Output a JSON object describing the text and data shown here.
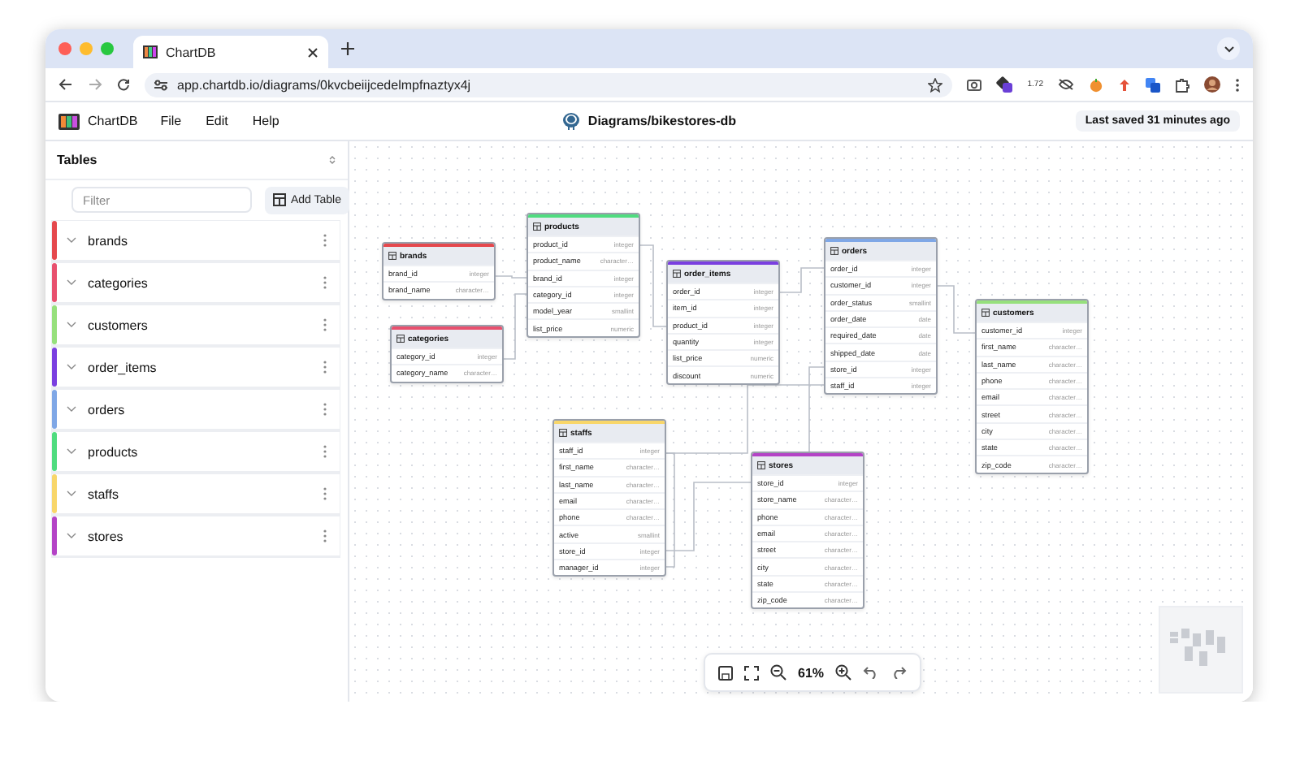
{
  "browser": {
    "tab_title": "ChartDB",
    "url": "app.chartdb.io/diagrams/0kvcbeiijcedelmpfnaztyx4j",
    "extension_badge": "1.72"
  },
  "app": {
    "logo_text": "ChartDB",
    "menu": [
      "File",
      "Edit",
      "Help"
    ],
    "diagram_title": "Diagrams/bikestores-db",
    "save_status": "Last saved 31 minutes ago"
  },
  "sidebar": {
    "title": "Tables",
    "filter": {
      "placeholder": "Filter"
    },
    "add_button": "Add Table",
    "items": [
      {
        "name": "brands",
        "color": "#e5484d"
      },
      {
        "name": "categories",
        "color": "#e8506e"
      },
      {
        "name": "customers",
        "color": "#96e07c"
      },
      {
        "name": "order_items",
        "color": "#7a3fe0"
      },
      {
        "name": "orders",
        "color": "#7fa7e6"
      },
      {
        "name": "products",
        "color": "#4fdc7f"
      },
      {
        "name": "staffs",
        "color": "#f8d66a"
      },
      {
        "name": "stores",
        "color": "#b443c6"
      }
    ]
  },
  "diagram": {
    "tables": [
      {
        "name": "brands",
        "color": "#e5484d",
        "columns": [
          {
            "name": "brand_id",
            "type": "integer"
          },
          {
            "name": "brand_name",
            "type": "character…"
          }
        ]
      },
      {
        "name": "categories",
        "color": "#e8506e",
        "columns": [
          {
            "name": "category_id",
            "type": "integer"
          },
          {
            "name": "category_name",
            "type": "character…"
          }
        ]
      },
      {
        "name": "products",
        "color": "#4fdc7f",
        "columns": [
          {
            "name": "product_id",
            "type": "integer"
          },
          {
            "name": "product_name",
            "type": "character…"
          },
          {
            "name": "brand_id",
            "type": "integer"
          },
          {
            "name": "category_id",
            "type": "integer"
          },
          {
            "name": "model_year",
            "type": "smallint"
          },
          {
            "name": "list_price",
            "type": "numeric"
          }
        ]
      },
      {
        "name": "order_items",
        "color": "#7a3fe0",
        "columns": [
          {
            "name": "order_id",
            "type": "integer"
          },
          {
            "name": "item_id",
            "type": "integer"
          },
          {
            "name": "product_id",
            "type": "integer"
          },
          {
            "name": "quantity",
            "type": "integer"
          },
          {
            "name": "list_price",
            "type": "numeric"
          },
          {
            "name": "discount",
            "type": "numeric"
          }
        ]
      },
      {
        "name": "orders",
        "color": "#7fa7e6",
        "columns": [
          {
            "name": "order_id",
            "type": "integer"
          },
          {
            "name": "customer_id",
            "type": "integer"
          },
          {
            "name": "order_status",
            "type": "smallint"
          },
          {
            "name": "order_date",
            "type": "date"
          },
          {
            "name": "required_date",
            "type": "date"
          },
          {
            "name": "shipped_date",
            "type": "date"
          },
          {
            "name": "store_id",
            "type": "integer"
          },
          {
            "name": "staff_id",
            "type": "integer"
          }
        ]
      },
      {
        "name": "customers",
        "color": "#96e07c",
        "columns": [
          {
            "name": "customer_id",
            "type": "integer"
          },
          {
            "name": "first_name",
            "type": "character…"
          },
          {
            "name": "last_name",
            "type": "character…"
          },
          {
            "name": "phone",
            "type": "character…"
          },
          {
            "name": "email",
            "type": "character…"
          },
          {
            "name": "street",
            "type": "character…"
          },
          {
            "name": "city",
            "type": "character…"
          },
          {
            "name": "state",
            "type": "character…"
          },
          {
            "name": "zip_code",
            "type": "character…"
          }
        ]
      },
      {
        "name": "staffs",
        "color": "#f8d66a",
        "columns": [
          {
            "name": "staff_id",
            "type": "integer"
          },
          {
            "name": "first_name",
            "type": "character…"
          },
          {
            "name": "last_name",
            "type": "character…"
          },
          {
            "name": "email",
            "type": "character…"
          },
          {
            "name": "phone",
            "type": "character…"
          },
          {
            "name": "active",
            "type": "smallint"
          },
          {
            "name": "store_id",
            "type": "integer"
          },
          {
            "name": "manager_id",
            "type": "integer"
          }
        ]
      },
      {
        "name": "stores",
        "color": "#b443c6",
        "columns": [
          {
            "name": "store_id",
            "type": "integer"
          },
          {
            "name": "store_name",
            "type": "character…"
          },
          {
            "name": "phone",
            "type": "character…"
          },
          {
            "name": "email",
            "type": "character…"
          },
          {
            "name": "street",
            "type": "character…"
          },
          {
            "name": "city",
            "type": "character…"
          },
          {
            "name": "state",
            "type": "character…"
          },
          {
            "name": "zip_code",
            "type": "character…"
          }
        ]
      }
    ]
  },
  "toolbar": {
    "zoom": "61%"
  }
}
